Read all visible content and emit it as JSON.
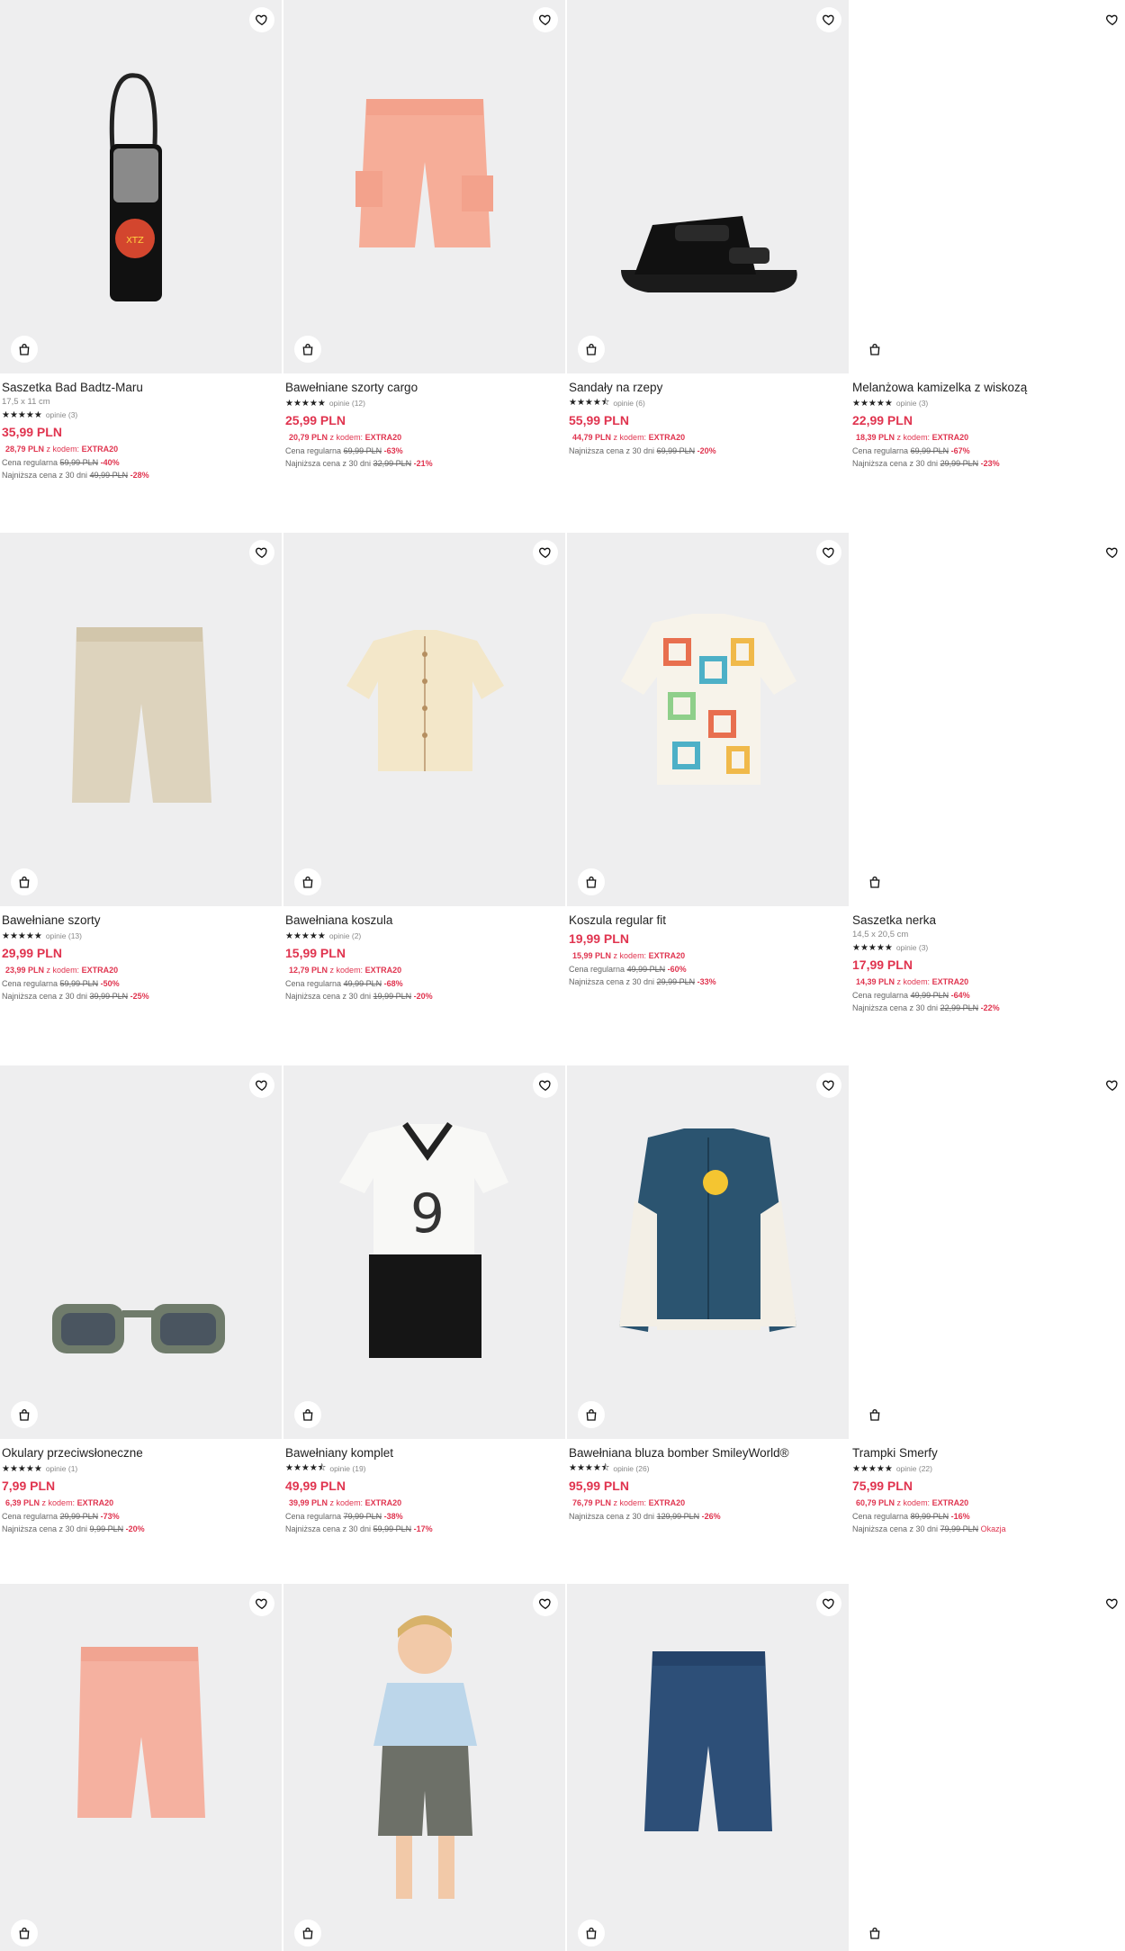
{
  "ui": {
    "reviews_prefix": "opinie",
    "code_prefix": "z kodem:",
    "regular_label": "Cena regularna",
    "lowest_label": "Najniższa cena z 30 dni"
  },
  "icons": {
    "favorite": "heart-outline-icon",
    "add_to_cart": "shopping-bag-icon"
  },
  "colors": {
    "price": "#e0344f",
    "image_bg": "#eeeeef"
  },
  "products": [
    {
      "name": "Saszetka Bad Badtz-Maru",
      "size": "17,5 x 11 cm",
      "stars": "★★★★★",
      "reviews": "opinie (3)",
      "price": "35,99 PLN",
      "promo_price": "28,79 PLN",
      "code": "EXTRA20",
      "regular": "59,99 PLN",
      "regular_disc": "-40%",
      "lowest": "49,99 PLN",
      "lowest_disc": "-28%",
      "extra": ""
    },
    {
      "name": "Bawełniane szorty cargo",
      "size": "",
      "stars": "★★★★★",
      "reviews": "opinie (12)",
      "price": "25,99 PLN",
      "promo_price": "20,79 PLN",
      "code": "EXTRA20",
      "regular": "69,99 PLN",
      "regular_disc": "-63%",
      "lowest": "32,99 PLN",
      "lowest_disc": "-21%",
      "extra": ""
    },
    {
      "name": "Sandały na rzepy",
      "size": "",
      "stars": "★★★★⯪",
      "reviews": "opinie (6)",
      "price": "55,99 PLN",
      "promo_price": "44,79 PLN",
      "code": "EXTRA20",
      "regular": "",
      "regular_disc": "",
      "lowest": "69,99 PLN",
      "lowest_disc": "-20%",
      "extra": ""
    },
    {
      "name": "Melanżowa kamizelka z wiskozą",
      "size": "",
      "stars": "★★★★★",
      "reviews": "opinie (3)",
      "price": "22,99 PLN",
      "promo_price": "18,39 PLN",
      "code": "EXTRA20",
      "regular": "69,99 PLN",
      "regular_disc": "-67%",
      "lowest": "29,99 PLN",
      "lowest_disc": "-23%",
      "extra": ""
    },
    {
      "name": "Bawełniane szorty",
      "size": "",
      "stars": "★★★★★",
      "reviews": "opinie (13)",
      "price": "29,99 PLN",
      "promo_price": "23,99 PLN",
      "code": "EXTRA20",
      "regular": "59,99 PLN",
      "regular_disc": "-50%",
      "lowest": "39,99 PLN",
      "lowest_disc": "-25%",
      "extra": ""
    },
    {
      "name": "Bawełniana koszula",
      "size": "",
      "stars": "★★★★★",
      "reviews": "opinie (2)",
      "price": "15,99 PLN",
      "promo_price": "12,79 PLN",
      "code": "EXTRA20",
      "regular": "49,99 PLN",
      "regular_disc": "-68%",
      "lowest": "19,99 PLN",
      "lowest_disc": "-20%",
      "extra": ""
    },
    {
      "name": "Koszula regular fit",
      "size": "",
      "stars": "",
      "reviews": "",
      "price": "19,99 PLN",
      "promo_price": "15,99 PLN",
      "code": "EXTRA20",
      "regular": "49,99 PLN",
      "regular_disc": "-60%",
      "lowest": "29,99 PLN",
      "lowest_disc": "-33%",
      "extra": ""
    },
    {
      "name": "Saszetka nerka",
      "size": "14,5 x 20,5 cm",
      "stars": "★★★★★",
      "reviews": "opinie (3)",
      "price": "17,99 PLN",
      "promo_price": "14,39 PLN",
      "code": "EXTRA20",
      "regular": "49,99 PLN",
      "regular_disc": "-64%",
      "lowest": "22,99 PLN",
      "lowest_disc": "-22%",
      "extra": ""
    },
    {
      "name": "Okulary przeciwsłoneczne",
      "size": "",
      "stars": "★★★★★",
      "reviews": "opinie (1)",
      "price": "7,99 PLN",
      "promo_price": "6,39 PLN",
      "code": "EXTRA20",
      "regular": "29,99 PLN",
      "regular_disc": "-73%",
      "lowest": "9,99 PLN",
      "lowest_disc": "-20%",
      "extra": ""
    },
    {
      "name": "Bawełniany komplet",
      "size": "",
      "stars": "★★★★⯪",
      "reviews": "opinie (19)",
      "price": "49,99 PLN",
      "promo_price": "39,99 PLN",
      "code": "EXTRA20",
      "regular": "79,99 PLN",
      "regular_disc": "-38%",
      "lowest": "59,99 PLN",
      "lowest_disc": "-17%",
      "extra": ""
    },
    {
      "name": "Bawełniana bluza bomber SmileyWorld®",
      "size": "",
      "stars": "★★★★⯪",
      "reviews": "opinie (26)",
      "price": "95,99 PLN",
      "promo_price": "76,79 PLN",
      "code": "EXTRA20",
      "regular": "",
      "regular_disc": "",
      "lowest": "129,99 PLN",
      "lowest_disc": "-26%",
      "extra": ""
    },
    {
      "name": "Trampki Smerfy",
      "size": "",
      "stars": "★★★★★",
      "reviews": "opinie (22)",
      "price": "75,99 PLN",
      "promo_price": "60,79 PLN",
      "code": "EXTRA20",
      "regular": "89,99 PLN",
      "regular_disc": "-16%",
      "lowest": "79,99 PLN",
      "lowest_disc": "",
      "extra": "Okazja"
    },
    {
      "name": "",
      "size": "",
      "stars": "",
      "reviews": "",
      "price": "",
      "promo_price": "",
      "code": "",
      "regular": "",
      "regular_disc": "",
      "lowest": "",
      "lowest_disc": "",
      "extra": ""
    },
    {
      "name": "",
      "size": "",
      "stars": "",
      "reviews": "",
      "price": "",
      "promo_price": "",
      "code": "",
      "regular": "",
      "regular_disc": "",
      "lowest": "",
      "lowest_disc": "",
      "extra": ""
    },
    {
      "name": "",
      "size": "",
      "stars": "",
      "reviews": "",
      "price": "",
      "promo_price": "",
      "code": "",
      "regular": "",
      "regular_disc": "",
      "lowest": "",
      "lowest_disc": "",
      "extra": ""
    },
    {
      "name": "",
      "size": "",
      "stars": "",
      "reviews": "",
      "price": "",
      "promo_price": "",
      "code": "",
      "regular": "",
      "regular_disc": "",
      "lowest": "",
      "lowest_disc": "",
      "extra": ""
    }
  ]
}
